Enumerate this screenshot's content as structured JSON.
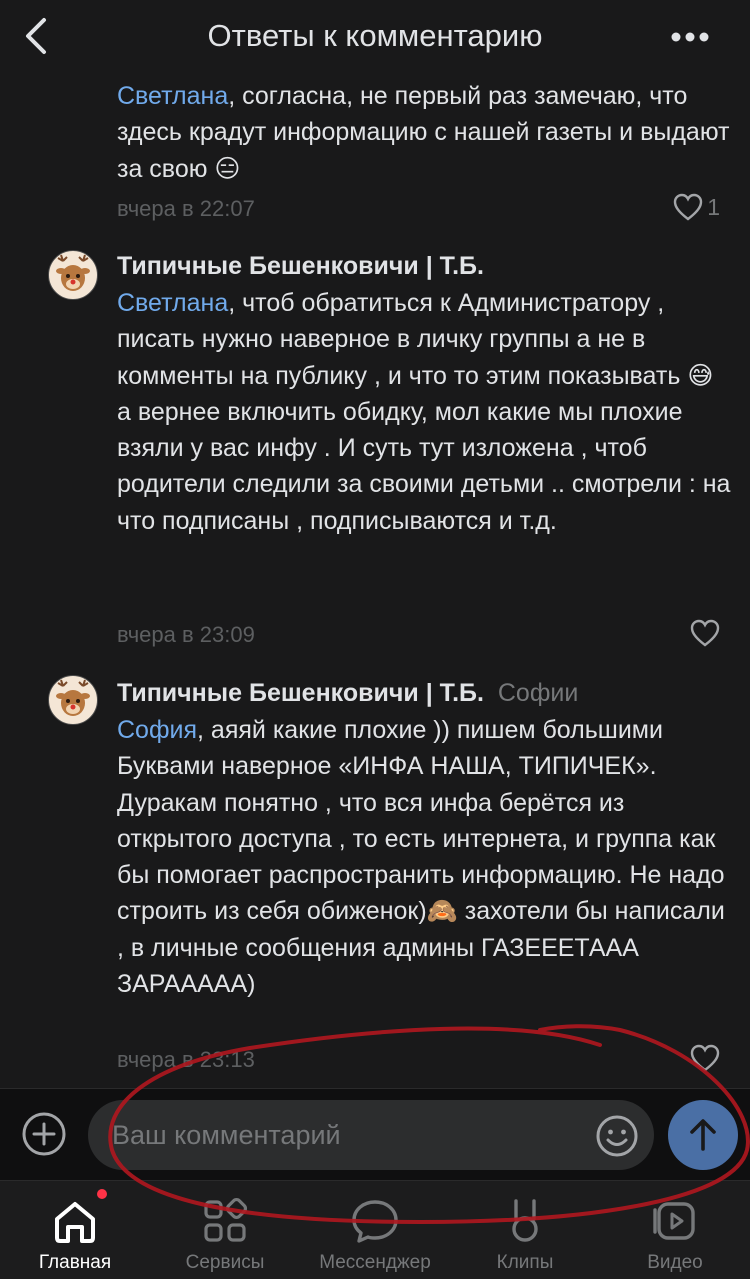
{
  "header": {
    "title": "Ответы к комментарию"
  },
  "comments": [
    {
      "mention": "Светлана",
      "text": ", согласна, не первый раз замечаю, что здесь крадут информацию с нашей газеты и выдают за свою 😑",
      "time": "вчера в 22:07",
      "likes": "1"
    },
    {
      "author": "Типичные Бешенковичи | Т.Б.",
      "mention": "Светлана",
      "text": ", чтоб обратиться к Администратору , писать нужно наверное в личку группы а не в комменты на публику , и что то этим показывать 😅 а вернее включить обидку, мол какие мы плохие взяли у вас инфу . И суть тут изложена , чтоб родители следили за своими детьми .. смотрели : на что подписаны , подписываются и т.д.",
      "time": "вчера в 23:09"
    },
    {
      "author": "Типичные Бешенковичи | Т.Б.",
      "reply_to": "Софии",
      "mention": "София",
      "text": ", аяяй какие плохие )) пишем большими Буквами наверное «ИНФА НАША, ТИПИЧЕК». Дуракам понятно , что вся инфа берётся из открытого доступа , то есть интернета, и группа как бы помогает распространить информацию. Не надо строить из себя обиженок)🙈 захотели бы написали , в личные сообщения админы ГАЗЕЕЕТААА ЗАРААААА)",
      "time": "вчера в 23:13"
    }
  ],
  "composer": {
    "placeholder": "Ваш комментарий"
  },
  "tabs": [
    {
      "label": "Главная",
      "icon": "home-icon",
      "active": true
    },
    {
      "label": "Сервисы",
      "icon": "services-icon"
    },
    {
      "label": "Мессенджер",
      "icon": "messenger-icon"
    },
    {
      "label": "Клипы",
      "icon": "clips-icon"
    },
    {
      "label": "Видео",
      "icon": "video-icon"
    }
  ],
  "colors": {
    "accent": "#71aaeb",
    "background": "#19191a",
    "annotation": "#b0171f"
  }
}
